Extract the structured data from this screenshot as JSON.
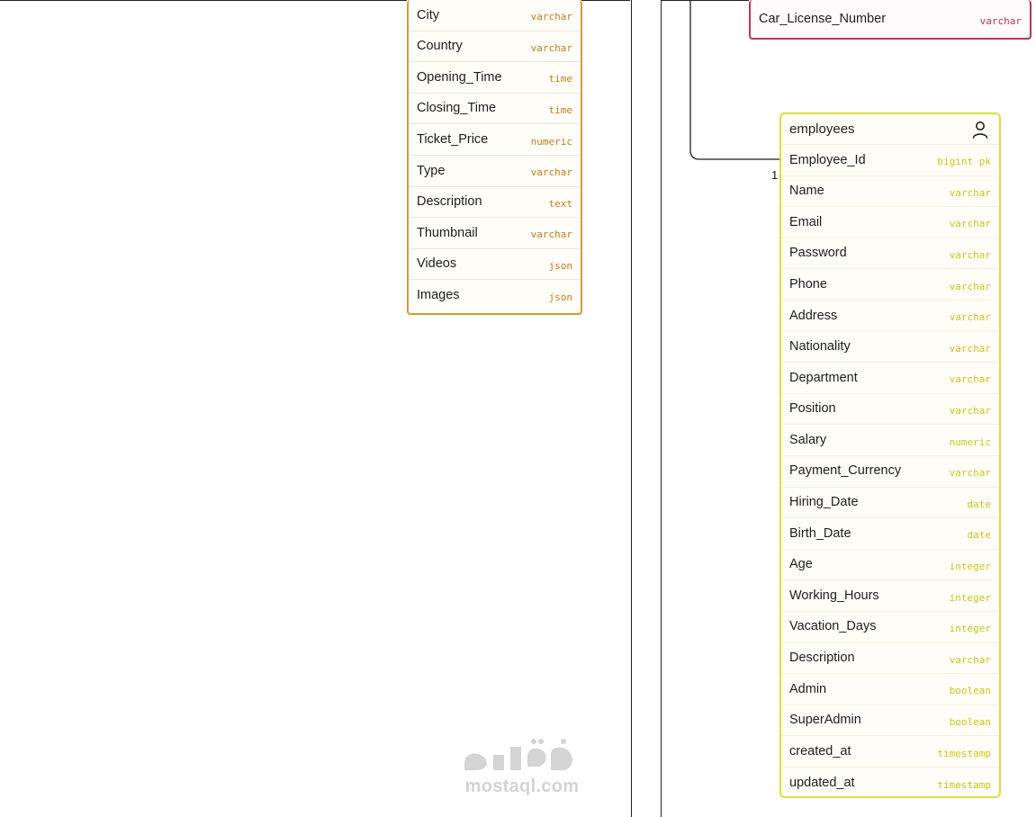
{
  "diagram": {
    "relationship": {
      "cardinality_label": "1"
    },
    "watermark": {
      "text": "mostaql.com",
      "logo_text": "مستقل"
    }
  },
  "tables": {
    "left_table": {
      "rows": [
        {
          "name": "City",
          "type": "varchar"
        },
        {
          "name": "Country",
          "type": "varchar"
        },
        {
          "name": "Opening_Time",
          "type": "time"
        },
        {
          "name": "Closing_Time",
          "type": "time"
        },
        {
          "name": "Ticket_Price",
          "type": "numeric"
        },
        {
          "name": "Type",
          "type": "varchar"
        },
        {
          "name": "Description",
          "type": "text"
        },
        {
          "name": "Thumbnail",
          "type": "varchar"
        },
        {
          "name": "Videos",
          "type": "json"
        },
        {
          "name": "Images",
          "type": "json"
        }
      ]
    },
    "top_right_table": {
      "rows": [
        {
          "name": "Car_License_Number",
          "type": "varchar"
        }
      ]
    },
    "employees": {
      "title": "employees",
      "icon": "user-icon",
      "rows": [
        {
          "name": "Employee_Id",
          "type": "bigint pk"
        },
        {
          "name": "Name",
          "type": "varchar"
        },
        {
          "name": "Email",
          "type": "varchar"
        },
        {
          "name": "Password",
          "type": "varchar"
        },
        {
          "name": "Phone",
          "type": "varchar"
        },
        {
          "name": "Address",
          "type": "varchar"
        },
        {
          "name": "Nationality",
          "type": "varchar"
        },
        {
          "name": "Department",
          "type": "varchar"
        },
        {
          "name": "Position",
          "type": "varchar"
        },
        {
          "name": "Salary",
          "type": "numeric"
        },
        {
          "name": "Payment_Currency",
          "type": "varchar"
        },
        {
          "name": "Hiring_Date",
          "type": "date"
        },
        {
          "name": "Birth_Date",
          "type": "date"
        },
        {
          "name": "Age",
          "type": "integer"
        },
        {
          "name": "Working_Hours",
          "type": "integer"
        },
        {
          "name": "Vacation_Days",
          "type": "integer"
        },
        {
          "name": "Description",
          "type": "varchar"
        },
        {
          "name": "Admin",
          "type": "boolean"
        },
        {
          "name": "SuperAdmin",
          "type": "boolean"
        },
        {
          "name": "created_at",
          "type": "timestamp"
        },
        {
          "name": "updated_at",
          "type": "timestamp"
        }
      ]
    }
  },
  "colors": {
    "left_table_accent": "#d39a3a",
    "employees_accent": "#d8de44",
    "top_right_accent": "#b9384a",
    "connector": "#1f1f1f"
  }
}
